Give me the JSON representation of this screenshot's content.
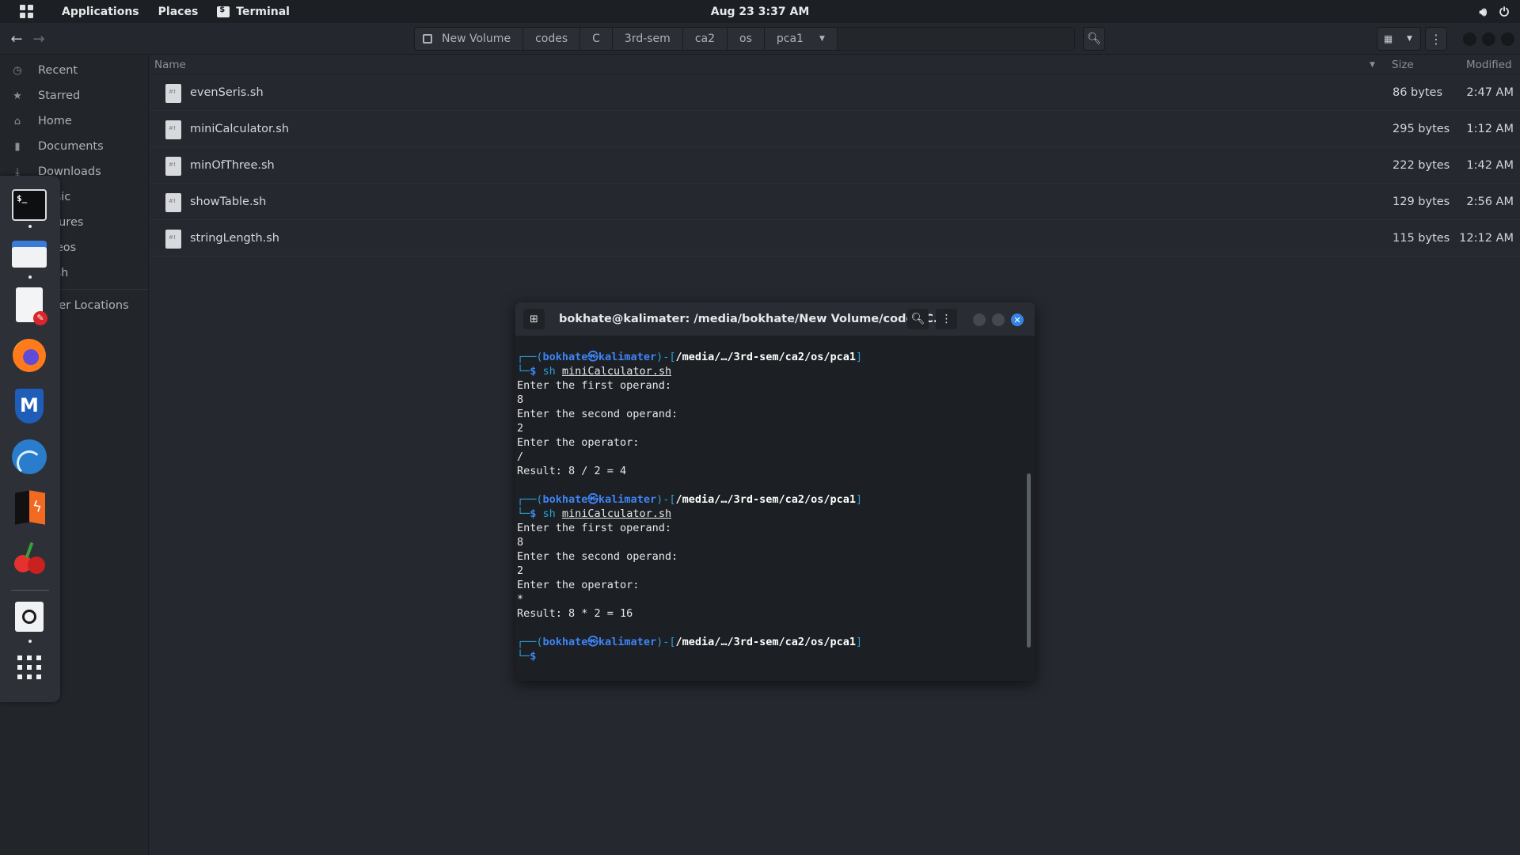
{
  "topbar": {
    "applications": "Applications",
    "places": "Places",
    "terminal": "Terminal",
    "clock": "Aug 23  3:37 AM"
  },
  "pathbar": {
    "crumbs": [
      "New Volume",
      "codes",
      "C",
      "3rd-sem",
      "ca2",
      "os",
      "pca1"
    ]
  },
  "sidebar": {
    "items": [
      {
        "label": "Recent",
        "icon": "clock-icon"
      },
      {
        "label": "Starred",
        "icon": "star-icon"
      },
      {
        "label": "Home",
        "icon": "home-icon"
      },
      {
        "label": "Documents",
        "icon": "document-icon"
      },
      {
        "label": "Downloads",
        "icon": "download-icon"
      },
      {
        "label": "Music",
        "icon": "music-icon"
      },
      {
        "label": "Pictures",
        "icon": "picture-icon"
      },
      {
        "label": "Videos",
        "icon": "video-icon"
      },
      {
        "label": "Trash",
        "icon": "trash-icon"
      },
      {
        "label": "Other Locations",
        "icon": "plus-icon"
      }
    ]
  },
  "filelist": {
    "headers": {
      "name": "Name",
      "size": "Size",
      "modified": "Modified"
    },
    "rows": [
      {
        "name": "evenSeris.sh",
        "size": "86 bytes",
        "modified": "2:47 AM"
      },
      {
        "name": "miniCalculator.sh",
        "size": "295 bytes",
        "modified": "1:12 AM"
      },
      {
        "name": "minOfThree.sh",
        "size": "222 bytes",
        "modified": "1:42 AM"
      },
      {
        "name": "showTable.sh",
        "size": "129 bytes",
        "modified": "2:56 AM"
      },
      {
        "name": "stringLength.sh",
        "size": "115 bytes",
        "modified": "12:12 AM"
      }
    ]
  },
  "terminal": {
    "title": "bokhate@kalimater: /media/bokhate/New Volume/codes/C...",
    "prompt_user": "bokhate",
    "prompt_host": "kalimater",
    "prompt_path": "/media/…/3rd-sem/ca2/os/pca1",
    "cmd_prefix": "sh ",
    "cmd_file": "miniCalculator.sh",
    "session1": [
      "Enter the first operand:",
      "8",
      "Enter the second operand:",
      "2",
      "Enter the operator:",
      "/",
      "Result: 8 / 2 = 4"
    ],
    "session2": [
      "Enter the first operand:",
      "8",
      "Enter the second operand:",
      "2",
      "Enter the operator:",
      "*",
      "Result: 8 * 2 = 16"
    ]
  },
  "colors": {
    "accent": "#3584e4",
    "prompt_blue": "#3f84f5",
    "prompt_cyan": "#2a9fd6"
  }
}
